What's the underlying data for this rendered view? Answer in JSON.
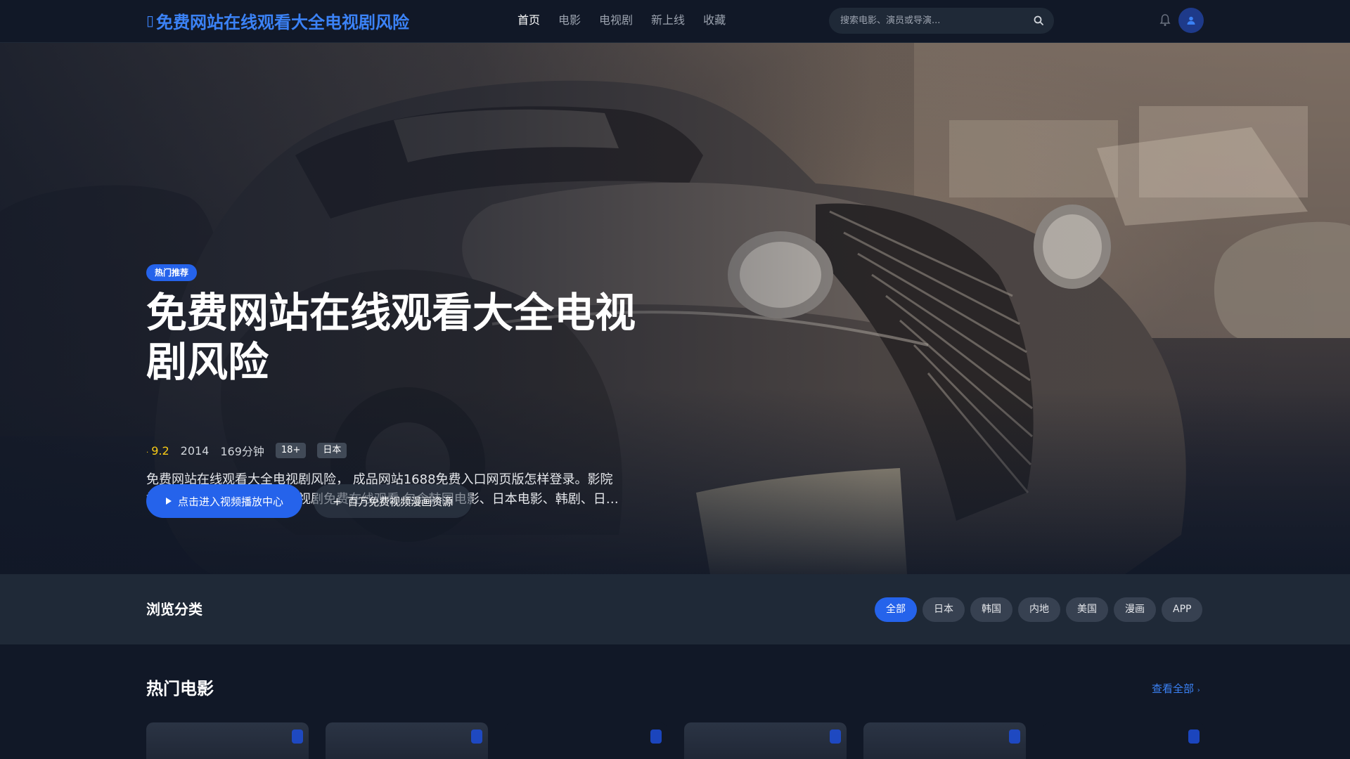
{
  "header": {
    "logo_text": "免费网站在线观看大全电视剧风险",
    "nav": [
      {
        "label": "首页",
        "active": true
      },
      {
        "label": "电影",
        "active": false
      },
      {
        "label": "电视剧",
        "active": false
      },
      {
        "label": "新上线",
        "active": false
      },
      {
        "label": "收藏",
        "active": false
      }
    ],
    "search_placeholder": "搜索电影、演员或导演..."
  },
  "hero": {
    "badge": "热门推荐",
    "title": "免费网站在线观看大全电视剧风险",
    "rating": "9.2",
    "year": "2014",
    "duration": "169分钟",
    "age_tag": "18+",
    "region_tag": "日本",
    "description": "免费网站在线观看大全电视剧风险， 成品网站1688免费入口网页版怎样登录。影院提供最新热门高清电影、电视剧免费在线观看,包含韩国电影、日本电影、韩剧、日剧、美剧等海量资源",
    "primary_button": "点击进入视频播放中心",
    "secondary_button": "百万免费视频漫画资源"
  },
  "categories": {
    "title": "浏览分类",
    "chips": [
      "全部",
      "日本",
      "韩国",
      "内地",
      "美国",
      "漫画",
      "APP"
    ]
  },
  "hot_movies": {
    "title": "热门电影",
    "view_all": "查看全部"
  },
  "colors": {
    "accent": "#2563eb",
    "link": "#3b82f6",
    "background": "#111827",
    "panel": "#1f2937",
    "rating": "#facc15"
  },
  "icons": {
    "logo": "film-icon",
    "search": "search-icon",
    "notification": "bell-icon",
    "user": "user-icon",
    "rating": "star-icon",
    "play": "play-icon",
    "add": "plus-icon",
    "view_all": "chevron-right-icon"
  }
}
